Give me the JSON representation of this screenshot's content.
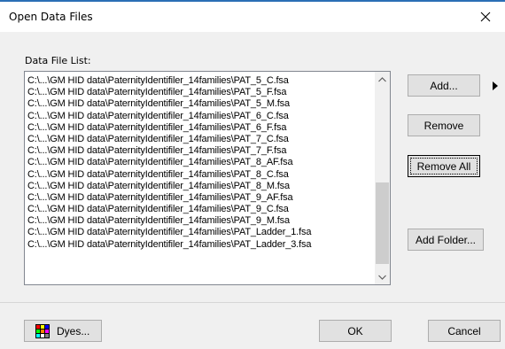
{
  "window": {
    "title": "Open Data Files",
    "close_icon": "close-icon"
  },
  "file_list": {
    "label": "Data File List:",
    "items": [
      "C:\\...\\GM HID data\\PaternityIdentifiler_14families\\PAT_5_C.fsa",
      "C:\\...\\GM HID data\\PaternityIdentifiler_14families\\PAT_5_F.fsa",
      "C:\\...\\GM HID data\\PaternityIdentifiler_14families\\PAT_5_M.fsa",
      "C:\\...\\GM HID data\\PaternityIdentifiler_14families\\PAT_6_C.fsa",
      "C:\\...\\GM HID data\\PaternityIdentifiler_14families\\PAT_6_F.fsa",
      "C:\\...\\GM HID data\\PaternityIdentifiler_14families\\PAT_7_C.fsa",
      "C:\\...\\GM HID data\\PaternityIdentifiler_14families\\PAT_7_F.fsa",
      "C:\\...\\GM HID data\\PaternityIdentifiler_14families\\PAT_8_AF.fsa",
      "C:\\...\\GM HID data\\PaternityIdentifiler_14families\\PAT_8_C.fsa",
      "C:\\...\\GM HID data\\PaternityIdentifiler_14families\\PAT_8_M.fsa",
      "C:\\...\\GM HID data\\PaternityIdentifiler_14families\\PAT_9_AF.fsa",
      "C:\\...\\GM HID data\\PaternityIdentifiler_14families\\PAT_9_C.fsa",
      "C:\\...\\GM HID data\\PaternityIdentifiler_14families\\PAT_9_M.fsa",
      "C:\\...\\GM HID data\\PaternityIdentifiler_14families\\PAT_Ladder_1.fsa",
      "C:\\...\\GM HID data\\PaternityIdentifiler_14families\\PAT_Ladder_3.fsa"
    ]
  },
  "buttons": {
    "add": "Add...",
    "remove": "Remove",
    "remove_all": "Remove All",
    "add_folder": "Add Folder...",
    "dyes": "Dyes...",
    "ok": "OK",
    "cancel": "Cancel"
  },
  "colors": {
    "accent": "#2b6fb5",
    "dialog_bg": "#f0f0f0",
    "button_bg": "#e1e1e1"
  }
}
